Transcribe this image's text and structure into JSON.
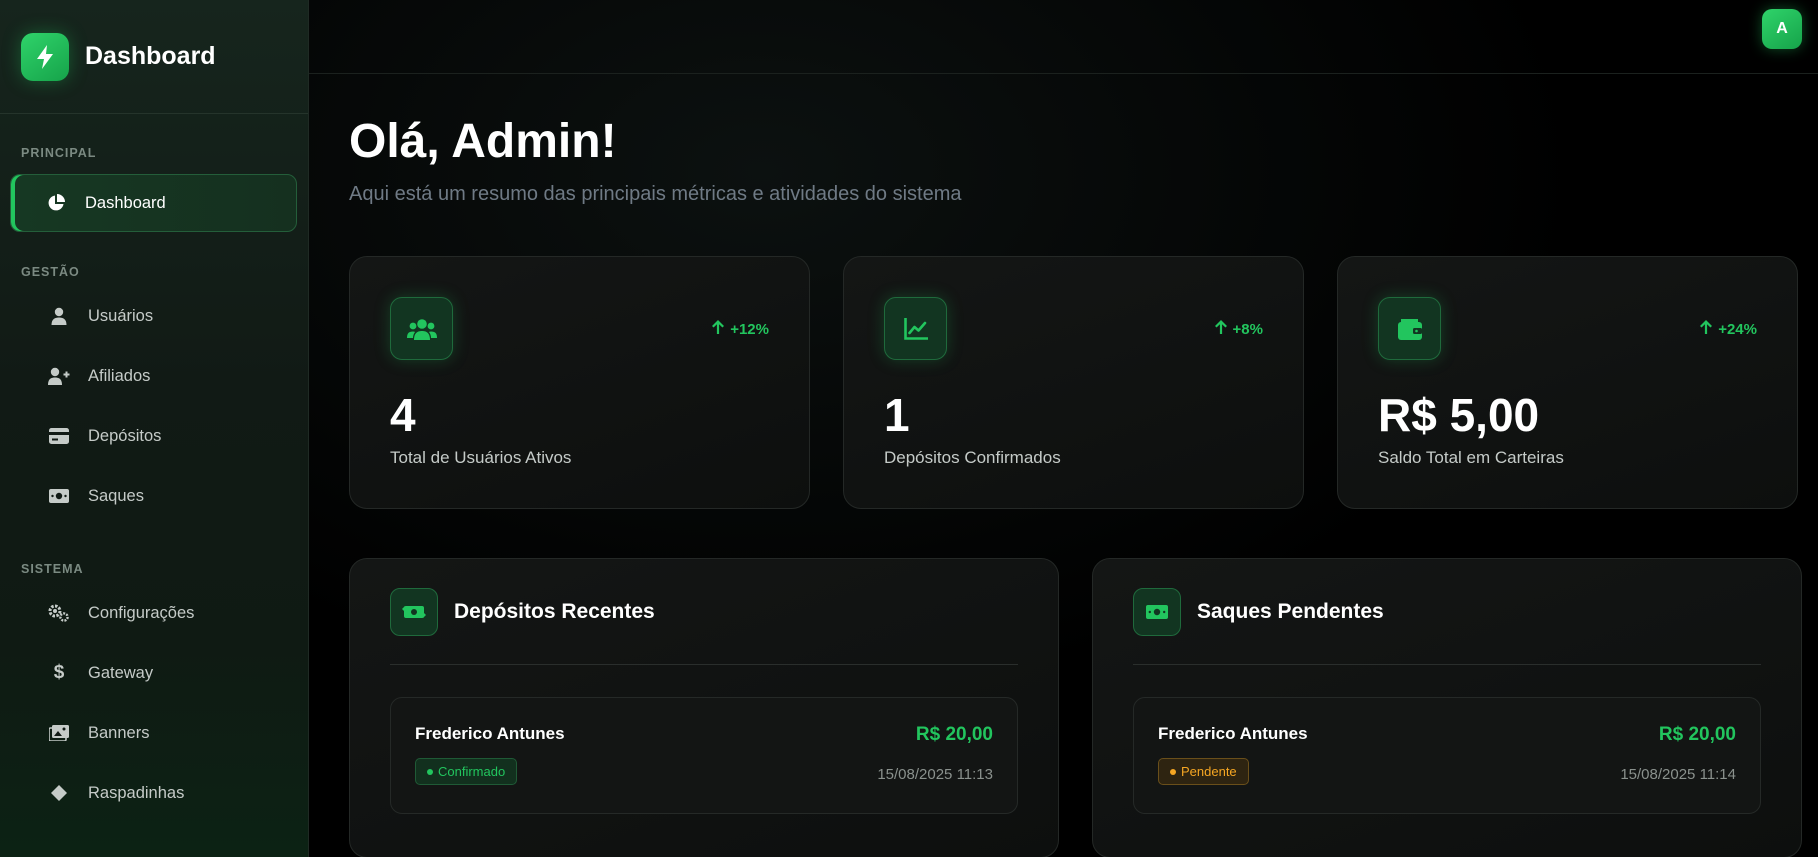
{
  "brand": {
    "title": "Dashboard"
  },
  "sidebar": {
    "sections": [
      {
        "label": "PRINCIPAL",
        "items": [
          {
            "label": "Dashboard",
            "icon": "pie-chart-icon",
            "active": true
          }
        ]
      },
      {
        "label": "GESTÃO",
        "items": [
          {
            "label": "Usuários",
            "icon": "user-icon"
          },
          {
            "label": "Afiliados",
            "icon": "user-plus-icon"
          },
          {
            "label": "Depósitos",
            "icon": "credit-card-icon"
          },
          {
            "label": "Saques",
            "icon": "money-bill-icon"
          }
        ]
      },
      {
        "label": "SISTEMA",
        "items": [
          {
            "label": "Configurações",
            "icon": "gears-icon"
          },
          {
            "label": "Gateway",
            "icon": "dollar-icon"
          },
          {
            "label": "Banners",
            "icon": "images-icon"
          },
          {
            "label": "Raspadinhas",
            "icon": "diamond-icon"
          }
        ]
      }
    ]
  },
  "topbar": {
    "avatar_initial": "A"
  },
  "header": {
    "greeting": "Olá, Admin!",
    "subtitle": "Aqui está um resumo das principais métricas e atividades do sistema"
  },
  "stats": [
    {
      "icon": "users-icon",
      "change": "+12%",
      "value": "4",
      "label": "Total de Usuários Ativos"
    },
    {
      "icon": "chart-line-icon",
      "change": "+8%",
      "value": "1",
      "label": "Depósitos Confirmados"
    },
    {
      "icon": "wallet-icon",
      "change": "+24%",
      "value": "R$ 5,00",
      "label": "Saldo Total em Carteiras"
    }
  ],
  "panels": {
    "deposits": {
      "title": "Depósitos Recentes",
      "icon": "money-bill-transfer-icon",
      "items": [
        {
          "name": "Frederico Antunes",
          "amount": "R$ 20,00",
          "status": "Confirmado",
          "date": "15/08/2025 11:13"
        }
      ]
    },
    "withdrawals": {
      "title": "Saques Pendentes",
      "icon": "money-bill-icon",
      "items": [
        {
          "name": "Frederico Antunes",
          "amount": "R$ 20,00",
          "status": "Pendente",
          "date": "15/08/2025 11:14"
        }
      ]
    }
  },
  "colors": {
    "accent": "#22c55e",
    "pending": "#f5a623",
    "background": "#000000"
  }
}
